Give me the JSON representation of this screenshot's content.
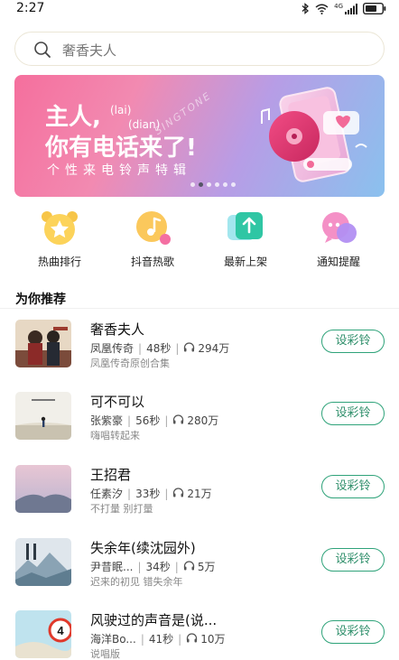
{
  "status": {
    "time": "2:27",
    "network": "4G"
  },
  "search": {
    "placeholder": "奢香夫人"
  },
  "banner": {
    "line1": "主人,",
    "lai": "(lai)",
    "dian": "(dian)",
    "line2": "你有电话来了!",
    "line3": "个性来电铃声特辑",
    "script": "SINGTONE",
    "slide_count": 6,
    "active_slide": 1
  },
  "categories": [
    {
      "label": "热曲排行",
      "icon": "trophy-icon"
    },
    {
      "label": "抖音热歌",
      "icon": "music-note-icon"
    },
    {
      "label": "最新上架",
      "icon": "upload-arrow-icon"
    },
    {
      "label": "通知提醒",
      "icon": "chat-bubble-icon"
    }
  ],
  "section": {
    "title": "为你推荐"
  },
  "songs": [
    {
      "title": "奢香夫人",
      "artist": "凤凰传奇",
      "duration": "48秒",
      "plays": "294万",
      "subtitle": "凤凰传奇原创合集",
      "button": "设彩铃"
    },
    {
      "title": "可不可以",
      "artist": "张紫豪",
      "duration": "56秒",
      "plays": "280万",
      "subtitle": "嗨唱转起来",
      "button": "设彩铃"
    },
    {
      "title": "王招君",
      "artist": "任素汐",
      "duration": "33秒",
      "plays": "21万",
      "subtitle": "不打量 别打量",
      "button": "设彩铃"
    },
    {
      "title": "失余年(续沈园外)",
      "artist": "尹昔眠...",
      "duration": "34秒",
      "plays": "5万",
      "subtitle": "迟来的初见 错失余年",
      "button": "设彩铃"
    },
    {
      "title": "风驶过的声音是(说...",
      "artist": "海洋Bo...",
      "duration": "41秒",
      "plays": "10万",
      "subtitle": "说唱版",
      "button": "设彩铃"
    }
  ]
}
